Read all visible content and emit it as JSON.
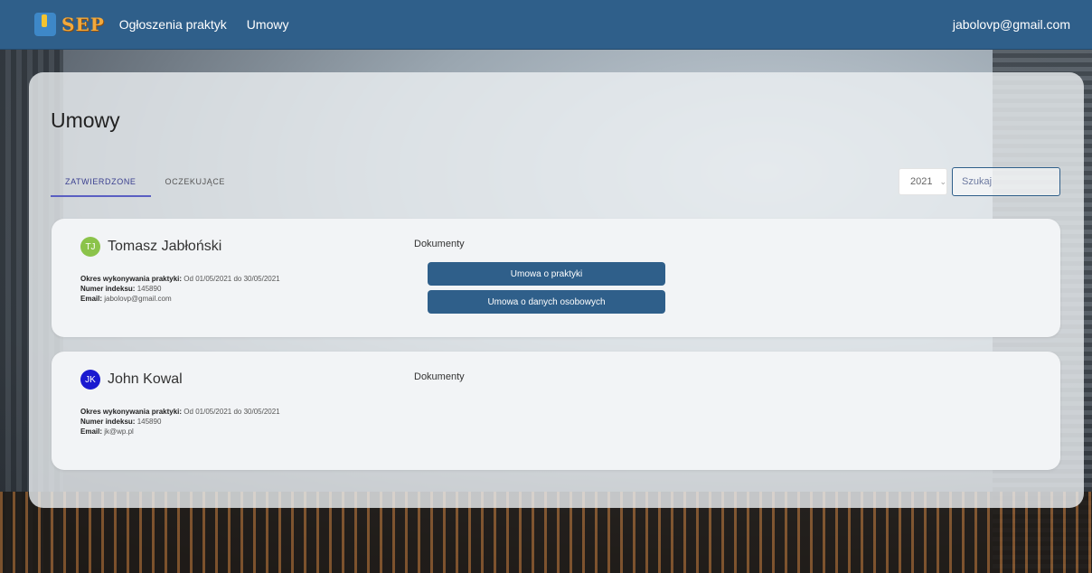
{
  "header": {
    "logo_text": "SEP",
    "nav": [
      "Ogłoszenia praktyk",
      "Umowy"
    ],
    "user_email": "jabolovp@gmail.com"
  },
  "page": {
    "title": "Umowy",
    "tabs": [
      {
        "label": "ZATWIERDZONE",
        "active": true
      },
      {
        "label": "OCZEKUJĄCE",
        "active": false
      }
    ],
    "year": "2021",
    "search_placeholder": "Szukaj"
  },
  "labels": {
    "period": "Okres wykonywania praktyki:",
    "index": "Numer indeksu:",
    "email": "Email:",
    "documents": "Dokumenty"
  },
  "contracts": [
    {
      "initials": "TJ",
      "avatar_color": "#8bc34a",
      "name": "Tomasz Jabłoński",
      "period": "Od 01/05/2021 do 30/05/2021",
      "index": "145890",
      "email": "jabolovp@gmail.com",
      "documents": [
        "Umowa o praktyki",
        "Umowa o danych osobowych"
      ]
    },
    {
      "initials": "JK",
      "avatar_color": "#1a1ad0",
      "name": "John Kowal",
      "period": "Od 01/05/2021 do 30/05/2021",
      "index": "145890",
      "email": "jk@wp.pl",
      "documents": []
    }
  ]
}
